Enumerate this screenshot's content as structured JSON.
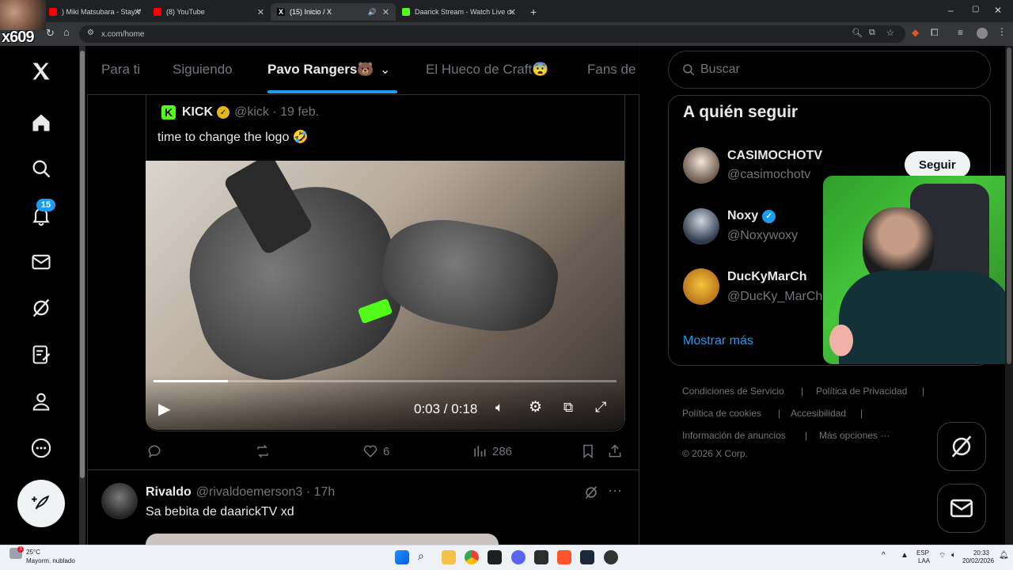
{
  "browser": {
    "tabs": [
      {
        "title": ") Miki Matsubara - Stay With …",
        "fav_color": "#ff0000"
      },
      {
        "title": "(8) YouTube",
        "fav_color": "#ff0000"
      },
      {
        "title": "(15) Inicio / X",
        "fav_color": "#000000",
        "active": true
      },
      {
        "title": "Daarick Stream - Watch Live o…",
        "fav_color": "#53fc18"
      }
    ],
    "url": "x.com/home"
  },
  "overlay": {
    "streamer_tag": "x609"
  },
  "nav": {
    "notification_count": "15"
  },
  "timeline_tabs": [
    "Para ti",
    "Siguiendo",
    "Pavo Rangers🐻",
    "El Hueco de Craft😨",
    "Fans de"
  ],
  "quote": {
    "name": "KICK",
    "handle": "@kick · 19 feb.",
    "text": "time to change the logo 🤣",
    "video_time": "0:03 / 0:18",
    "video_progress": 0.16
  },
  "actions": {
    "likes": "6",
    "views": "286"
  },
  "reply": {
    "name": "Rivaldo",
    "handle": "@rivaldoemerson3 · 17h",
    "text": "Sa bebita de daarickTV xd"
  },
  "sidebar": {
    "search_placeholder": "Buscar",
    "who_to_follow_title": "A quién seguir",
    "suggestions": [
      {
        "name": "CASIMOCHOTV",
        "handle": "@casimochotv",
        "verified": false
      },
      {
        "name": "Noxy",
        "handle": "@Noxywoxy",
        "verified": true
      },
      {
        "name": "DucKyMarCh",
        "handle": "@DucKy_MarCh",
        "verified": false
      }
    ],
    "follow_label": "Seguir",
    "show_more": "Mostrar más",
    "footer": [
      "Condiciones de Servicio",
      "Política de Privacidad",
      "Política de cookies",
      "Accesibilidad",
      "Información de anuncios",
      "Más opciones ···",
      "© 2026 X Corp."
    ]
  },
  "taskbar": {
    "weather_temp": "25°C",
    "weather_desc": "Mayorm. nublado",
    "lang1": "ESP",
    "lang2": "LAA",
    "time": "20:33",
    "date": "20/02/2026"
  },
  "colors": {
    "accent": "#1d9bf0",
    "kick_green": "#53fc18",
    "verified_gold": "#e2b719"
  }
}
